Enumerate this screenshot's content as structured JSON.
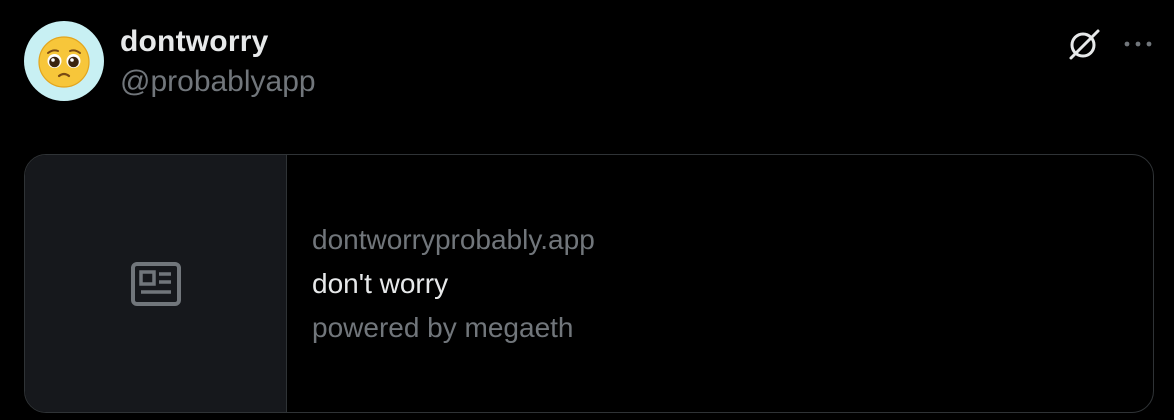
{
  "post": {
    "author": {
      "display_name": "dontworry",
      "handle": "@probablyapp",
      "avatar_icon": "pleading-face-emoji",
      "avatar_bg": "#c8f0f3"
    },
    "header_icons": [
      "verified-grok-icon",
      "more-options-icon"
    ]
  },
  "link_card": {
    "media_icon": "article-placeholder-icon",
    "domain": "dontworryprobably.app",
    "title": "don't worry",
    "description": "powered by megaeth"
  },
  "colors": {
    "background": "#000000",
    "primary_text": "#e7e9ea",
    "secondary_text": "#71767b",
    "border": "#2f3336",
    "card_media_bg": "#16181c"
  }
}
